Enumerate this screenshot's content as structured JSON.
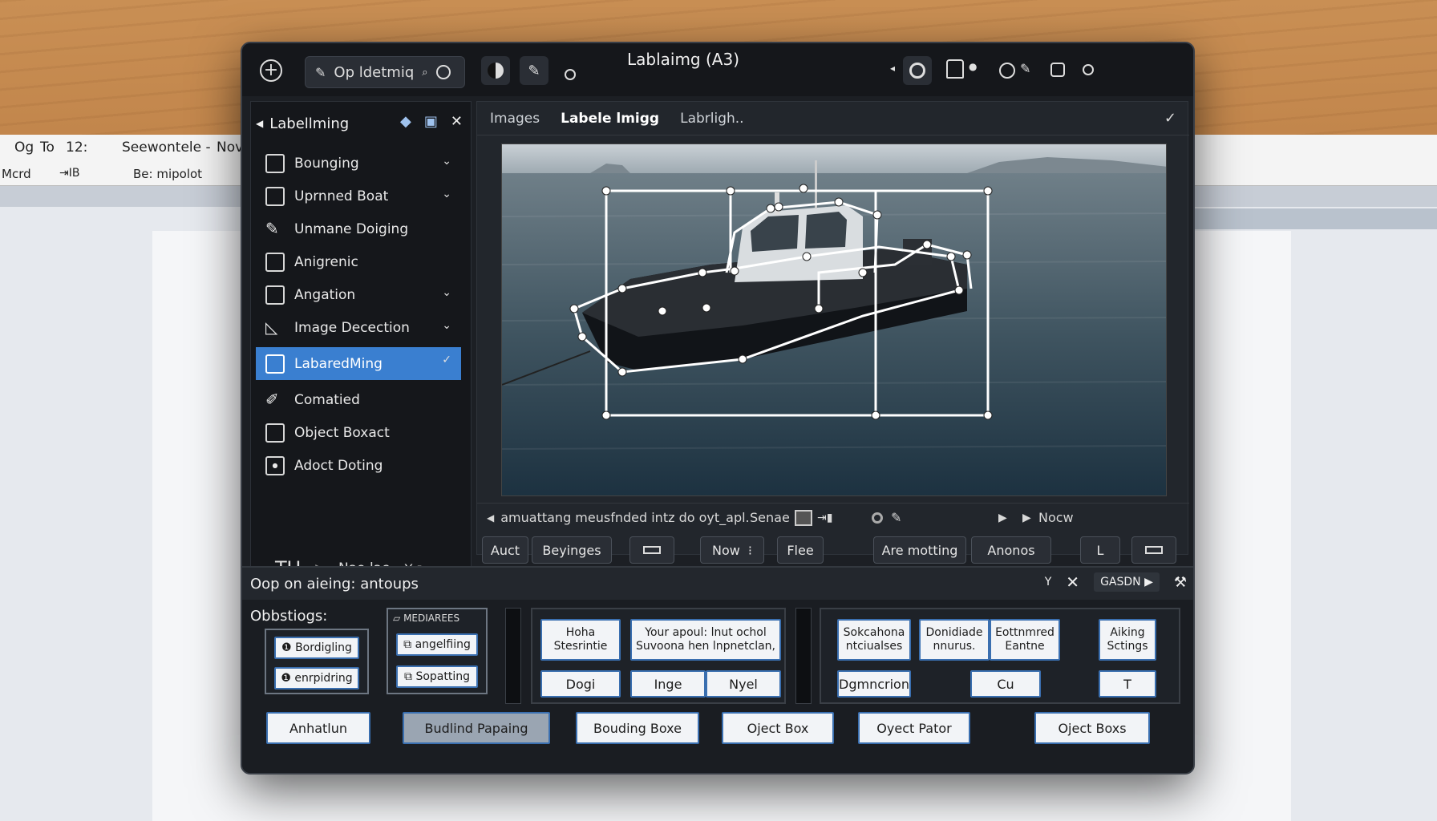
{
  "background": {
    "row1": [
      "Og",
      "To",
      "12:",
      "Seewontele -",
      "Nov"
    ],
    "row2": [
      "Mcrd",
      "⇥IB",
      "Be: mipolot"
    ]
  },
  "titlebar": {
    "title": "Lablaimg (A3)",
    "search_value": "Op ldetmiq"
  },
  "sidebar": {
    "title": "Labellming",
    "items": [
      {
        "label": "Bounging",
        "chevron": true
      },
      {
        "label": "Uprnned Boat",
        "chevron": true
      },
      {
        "label": "Unmane Doiging",
        "chevron": false
      },
      {
        "label": "Anigrenic",
        "chevron": false
      },
      {
        "label": "Angation",
        "chevron": true
      },
      {
        "label": "Image Decection",
        "chevron": true
      },
      {
        "label": "LabaredMing",
        "chevron": true,
        "active": true
      },
      {
        "label": "Comatied",
        "chevron": false
      },
      {
        "label": "Object Boxact",
        "chevron": false
      },
      {
        "label": "Adoct Doting",
        "chevron": false
      }
    ],
    "footer_label": "Nao lae"
  },
  "viewer": {
    "tabs": [
      "Images",
      "Labele lmigg",
      "Labrligh.."
    ],
    "status_text": "amuattang meusfnded intz do oyt_apl.",
    "status_mid": "Senae",
    "status_right": "Nocw",
    "buttons": [
      "Auct",
      "Beyinges",
      "Now",
      "Flee",
      "Are motting",
      "Anonos",
      "L"
    ]
  },
  "bottom": {
    "header": "Oop on aieing: antoups",
    "header_btn": "GASDN",
    "section_label": "Obbstiogs:",
    "group1": [
      "Bordigling",
      "enrpidring"
    ],
    "group2_header": "MEDIAREES",
    "group2": [
      "angelfiing",
      "Sopatting"
    ],
    "grid_a": [
      "Hoha Stesrintie",
      "Your apoul: lnut ochol Suvoona hen lnpnetclan,",
      "Dogi",
      "Inge",
      "Nyel"
    ],
    "grid_b": [
      "Sokcahona ntciualses",
      "Donidiade nnurus.",
      "Eottnmred Eantne",
      "Aiking Sctings",
      "Dgmncrion",
      "Cu",
      "T"
    ],
    "bottom_row": [
      "Anhatlun",
      "Budlind Papaing",
      "Bouding Boxe",
      "Oject Box",
      "Oyect Pator",
      "Oject Boxs"
    ]
  },
  "colors": {
    "accent": "#3a7fd0",
    "window_bg": "#1c1f24",
    "bbox": "#ffffff"
  }
}
